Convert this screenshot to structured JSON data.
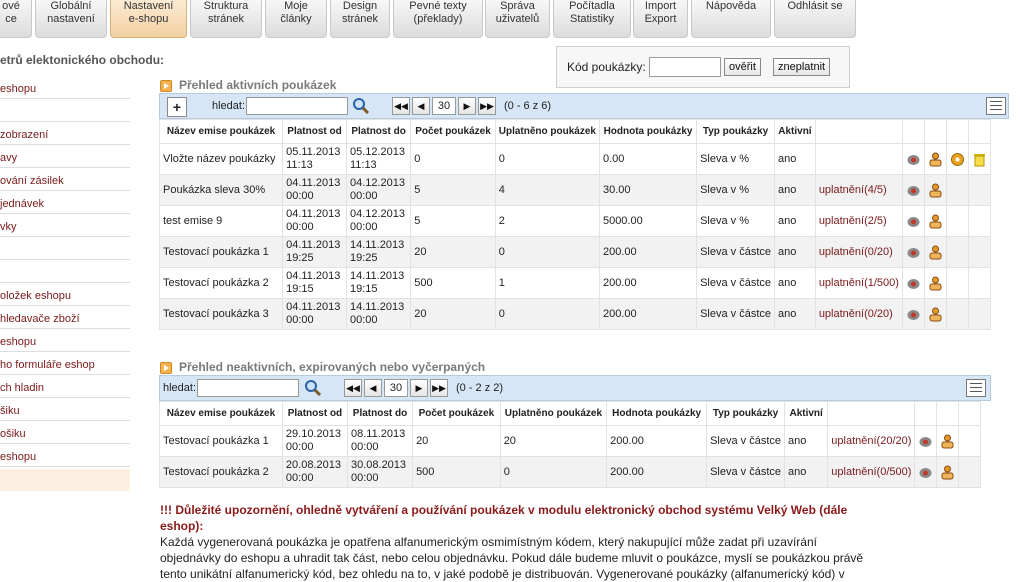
{
  "nav": {
    "tabs": [
      {
        "l1": "ové",
        "l2": "ce"
      },
      {
        "l1": "Globální",
        "l2": "nastavení"
      },
      {
        "l1": "Nastavení",
        "l2": "e-shopu",
        "active": true
      },
      {
        "l1": "Struktura",
        "l2": "stránek"
      },
      {
        "l1": "Moje",
        "l2": "články"
      },
      {
        "l1": "Design",
        "l2": "stránek"
      },
      {
        "l1": "Pevné texty",
        "l2": "(překlady)"
      },
      {
        "l1": "Správa",
        "l2": "uživatelů"
      },
      {
        "l1": "Počítadla",
        "l2": "Statistiky"
      },
      {
        "l1": "Import",
        "l2": "Export"
      },
      {
        "l1": "Nápověda",
        "l2": ""
      },
      {
        "l1": "Odhlásit se",
        "l2": ""
      }
    ]
  },
  "page_heading": "etrů elektonického obchodu:",
  "sidebar": {
    "items": [
      "eshopu",
      "zobrazení",
      "avy",
      "ování zásilek",
      "jednávek",
      "vky",
      "oložek eshopu",
      "hledavače zboží",
      "eshopu",
      "ho formuláře eshop",
      "ch hladin",
      "šiku",
      "ošiku",
      "eshopu"
    ]
  },
  "voucher_check": {
    "label": "Kód poukázky:",
    "value": "",
    "verify_button": "ověřit",
    "invalidate_button": "zneplatnit"
  },
  "active": {
    "title": "Přehled aktivních poukázek",
    "search_label": "hledat:",
    "search_value": "",
    "page_size": "30",
    "page_info": "(0 - 6 z 6)",
    "add_symbol": "+",
    "columns": [
      "Název emise poukázek",
      "Platnost od",
      "Platnost do",
      "Počet poukázek",
      "Uplatněno poukázek",
      "Hodnota poukázky",
      "Typ poukázky",
      "Aktivní"
    ],
    "rows": [
      {
        "name": "Vložte název poukázky",
        "from1": "05.11.2013",
        "from2": "11:13",
        "to1": "05.12.2013",
        "to2": "11:13",
        "count": "0",
        "used": "0",
        "value": "0.00",
        "type": "Sleva v %",
        "active": "ano",
        "link": ""
      },
      {
        "name": "Poukázka sleva 30%",
        "from1": "04.11.2013",
        "from2": "00:00",
        "to1": "04.12.2013",
        "to2": "00:00",
        "count": "5",
        "used": "4",
        "value": "30.00",
        "type": "Sleva v %",
        "active": "ano",
        "link": "uplatnění(4/5)"
      },
      {
        "name": "test emise 9",
        "from1": "04.11.2013",
        "from2": "00:00",
        "to1": "04.12.2013",
        "to2": "00:00",
        "count": "5",
        "used": "2",
        "value": "5000.00",
        "type": "Sleva v %",
        "active": "ano",
        "link": "uplatnění(2/5)"
      },
      {
        "name": "Testovací poukázka 1",
        "from1": "04.11.2013",
        "from2": "19:25",
        "to1": "14.11.2013",
        "to2": "19:25",
        "count": "20",
        "used": "0",
        "value": "200.00",
        "type": "Sleva v částce",
        "active": "ano",
        "link": "uplatnění(0/20)"
      },
      {
        "name": "Testovací poukázka 2",
        "from1": "04.11.2013",
        "from2": "19:15",
        "to1": "14.11.2013",
        "to2": "19:15",
        "count": "500",
        "used": "1",
        "value": "200.00",
        "type": "Sleva v částce",
        "active": "ano",
        "link": "uplatnění(1/500)"
      },
      {
        "name": "Testovací poukázka 3",
        "from1": "04.11.2013",
        "from2": "00:00",
        "to1": "14.11.2013",
        "to2": "00:00",
        "count": "20",
        "used": "0",
        "value": "200.00",
        "type": "Sleva v částce",
        "active": "ano",
        "link": "uplatnění(0/20)"
      }
    ]
  },
  "inactive": {
    "title": "Přehled neaktivních, expirovaných nebo vyčerpaných",
    "search_label": "hledat:",
    "search_value": "",
    "page_size": "30",
    "page_info": "(0 - 2 z 2)",
    "columns": [
      "Název emise poukázek",
      "Platnost od",
      "Platnost do",
      "Počet poukázek",
      "Uplatněno poukázek",
      "Hodnota poukázky",
      "Typ poukázky",
      "Aktivní"
    ],
    "rows": [
      {
        "name": "Testovací poukázka 1",
        "from1": "29.10.2013",
        "from2": "00:00",
        "to1": "08.11.2013",
        "to2": "00:00",
        "count": "20",
        "used": "20",
        "value": "200.00",
        "type": "Sleva v částce",
        "active": "ano",
        "link": "uplatnění(20/20)"
      },
      {
        "name": "Testovací poukázka 2",
        "from1": "20.08.2013",
        "from2": "00:00",
        "to1": "30.08.2013",
        "to2": "00:00",
        "count": "500",
        "used": "0",
        "value": "200.00",
        "type": "Sleva v částce",
        "active": "ano",
        "link": "uplatnění(0/500)"
      }
    ]
  },
  "notice": {
    "title": "!!! Důležité upozornění, ohledně vytváření a používání poukázek v modulu elektronický obchod systému Velký Web (dále eshop):",
    "line1": "Každá vygenerovaná poukázka je opatřena alfanumerickým osmimístným kódem, který nakupující může zadat při uzavírání",
    "line2": "objednávky do eshopu a uhradit tak část, nebo celou objednávku. Pokud dále budeme mluvit o poukázce, myslí se poukázkou právě",
    "line3": "tento unikátní alfanumerický kód, bez ohledu na to, v jaké podobě je distribuován. Vygenerované poukázky (alfanumerický kód) v"
  },
  "colors": {
    "accent": "#f2cfa1",
    "toolbar": "#d6e6f7",
    "link": "#7a1a1a"
  }
}
